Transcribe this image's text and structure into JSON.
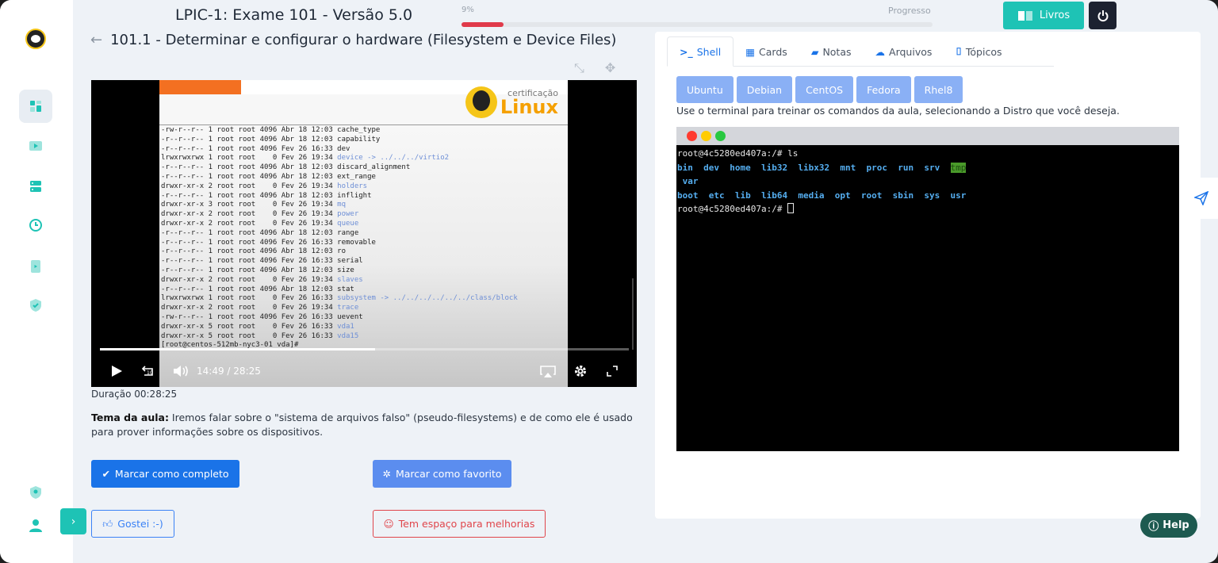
{
  "header": {
    "course_title": "LPIC-1: Exame 101 - Versão 5.0",
    "progress_percent_label": "9%",
    "progress_value": 0.09,
    "progress_label": "Progresso",
    "livros_label": "Livros"
  },
  "lesson": {
    "title": "101.1 - Determinar e configurar o hardware (Filesystem e Device Files)",
    "duration": "Duração 00:28:25",
    "tema_label": "Tema da aula:",
    "tema_text": " Iremos falar sobre o \"sistema de arquivos falso\" (pseudo-filesystems) e de como ele é usado para prover informações sobre os dispositivos."
  },
  "video": {
    "current_time": "14:49",
    "separator": "/",
    "total_time": "28:25",
    "played_fraction": 0.52,
    "slide_logo_small": "certificação",
    "slide_logo_big": "Linux",
    "slide_lines": [
      [
        "-rw-r--r-- 1 root root 4096 Abr 18 12:03 ",
        "cache_type",
        ""
      ],
      [
        "-r--r--r-- 1 root root 4096 Abr 18 12:03 ",
        "capability",
        ""
      ],
      [
        "-r--r--r-- 1 root root 4096 Fev 26 16:33 ",
        "dev",
        ""
      ],
      [
        "lrwxrwxrwx 1 root root    0 Fev 26 19:34 ",
        "",
        "device -> ../../../virtio2"
      ],
      [
        "-r--r--r-- 1 root root 4096 Abr 18 12:03 ",
        "discard_alignment",
        ""
      ],
      [
        "-r--r--r-- 1 root root 4096 Abr 18 12:03 ",
        "ext_range",
        ""
      ],
      [
        "drwxr-xr-x 2 root root    0 Fev 26 19:34 ",
        "",
        "holders"
      ],
      [
        "-r--r--r-- 1 root root 4096 Abr 18 12:03 ",
        "inflight",
        ""
      ],
      [
        "drwxr-xr-x 3 root root    0 Fev 26 19:34 ",
        "",
        "mq"
      ],
      [
        "drwxr-xr-x 2 root root    0 Fev 26 19:34 ",
        "",
        "power"
      ],
      [
        "drwxr-xr-x 2 root root    0 Fev 26 19:34 ",
        "",
        "queue"
      ],
      [
        "-r--r--r-- 1 root root 4096 Abr 18 12:03 ",
        "range",
        ""
      ],
      [
        "-r--r--r-- 1 root root 4096 Fev 26 16:33 ",
        "removable",
        ""
      ],
      [
        "-r--r--r-- 1 root root 4096 Abr 18 12:03 ",
        "ro",
        ""
      ],
      [
        "-r--r--r-- 1 root root 4096 Fev 26 16:33 ",
        "serial",
        ""
      ],
      [
        "-r--r--r-- 1 root root 4096 Abr 18 12:03 ",
        "size",
        ""
      ],
      [
        "drwxr-xr-x 2 root root    0 Fev 26 19:34 ",
        "",
        "slaves"
      ],
      [
        "-r--r--r-- 1 root root 4096 Abr 18 12:03 ",
        "stat",
        ""
      ],
      [
        "lrwxrwxrwx 1 root root    0 Fev 26 16:33 ",
        "",
        "subsystem -> ../../../../../../class/block"
      ],
      [
        "drwxr-xr-x 2 root root    0 Fev 26 19:34 ",
        "",
        "trace"
      ],
      [
        "-rw-r--r-- 1 root root 4096 Fev 26 16:33 ",
        "uevent",
        ""
      ],
      [
        "drwxr-xr-x 5 root root    0 Fev 26 16:33 ",
        "",
        "vda1"
      ],
      [
        "drwxr-xr-x 5 root root    0 Fev 26 16:33 ",
        "",
        "vda15"
      ],
      [
        "[root@centos-512mb-nyc3-01 vda]# ",
        "",
        ""
      ]
    ]
  },
  "actions": {
    "complete_label": "Marcar como completo",
    "favorite_label": "Marcar como favorito",
    "gostei_label": "Gostei :-)",
    "melhorias_label": "Tem espaço para melhorias"
  },
  "panel": {
    "tabs": [
      {
        "label": "Shell",
        "icon": "terminal-icon"
      },
      {
        "label": "Cards",
        "icon": "table-icon"
      },
      {
        "label": "Notas",
        "icon": "note-icon"
      },
      {
        "label": "Arquivos",
        "icon": "cloud-upload-icon"
      },
      {
        "label": "Tópicos",
        "icon": "bookmark-icon"
      }
    ],
    "distros": [
      "Ubuntu",
      "Debian",
      "CentOS",
      "Fedora",
      "Rhel8"
    ],
    "distro_help": "Use o terminal para treinar os comandos da aula, selecionando a Distro que você deseja.",
    "terminal": {
      "prompt_cmd": "root@4c5280ed407a:/# ls",
      "row1": [
        "bin",
        "dev",
        "home",
        "lib32",
        "libx32",
        "mnt",
        "proc",
        "run",
        "srv"
      ],
      "row1_highlight": "tmp",
      "row2": [
        "var"
      ],
      "row3": [
        "boot",
        "etc",
        "lib",
        "lib64",
        "media",
        "opt",
        "root",
        "sbin",
        "sys",
        "usr"
      ],
      "prompt": "root@4c5280ed407a:/# "
    }
  },
  "help_label": "Help",
  "colors": {
    "accent": "#1ec3b5",
    "primary": "#1a73e8",
    "danger": "#e0454b",
    "progress": "#e03a4a"
  }
}
